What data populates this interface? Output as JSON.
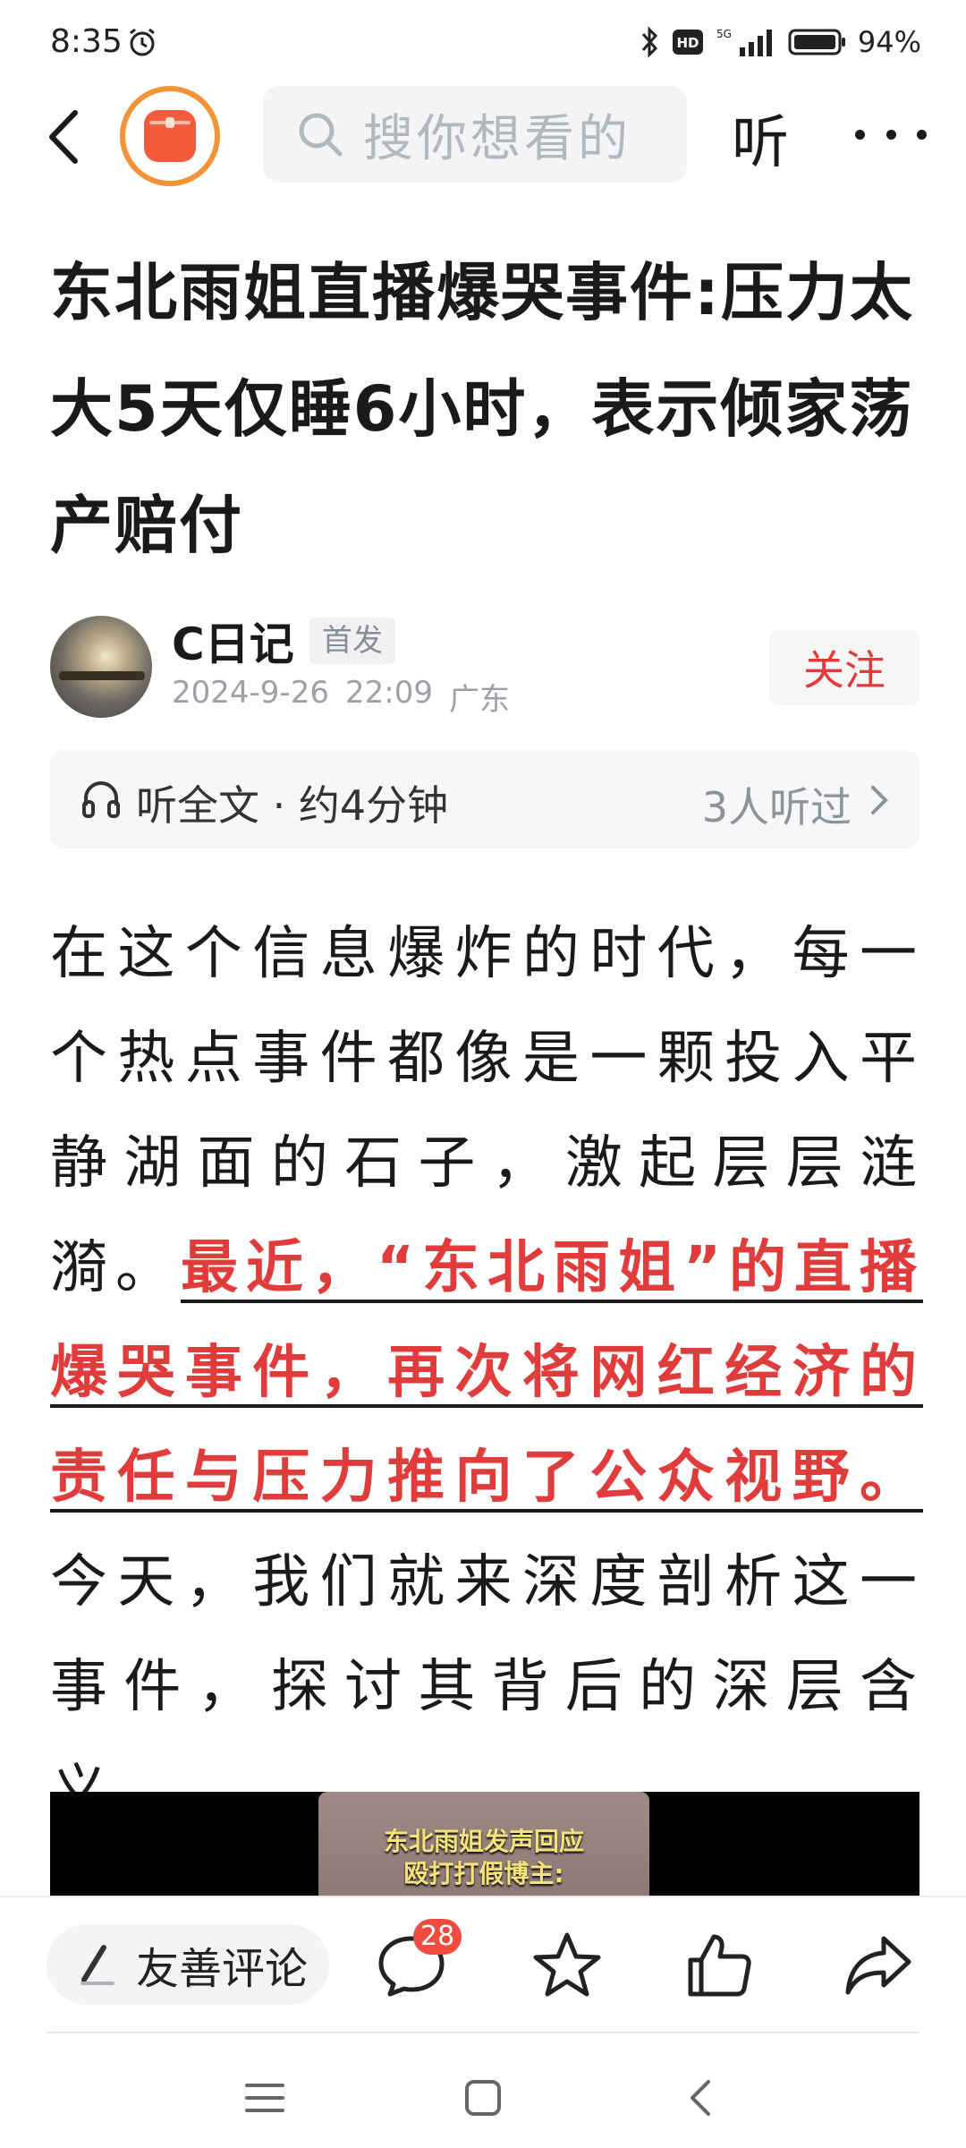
{
  "status_bar": {
    "time": "8:35",
    "network": "5G",
    "battery": "94%",
    "hd_badge": "HD"
  },
  "nav": {
    "search_placeholder": "搜你想看的",
    "listen_label": "听"
  },
  "article": {
    "title": "东北雨姐直播爆哭事件:压力太大5天仅睡6小时，表示倾家荡产赔付",
    "author": "C日记",
    "first_badge": "首发",
    "date": "2024-9-26",
    "time": "22:09",
    "location": "广东",
    "follow_label": "关注",
    "listen_full": "听全文 · 约4分钟",
    "listen_count": "3人听过",
    "body_part1": "在这个信息爆炸的时代，每一个热点事件都像是一颗投入平静湖面的石子，激起层层涟漪。",
    "body_highlight": "最近，“东北雨姐”的直播爆哭事件，再次将网红经济的责任与压力推向了公众视野。",
    "body_part2": "今天，我们就来深度剖析这一事件，探讨其背后的深层含义。",
    "video_caption_line1": "东北雨姐发声回应",
    "video_caption_line2": "殴打打假博主:"
  },
  "toolbar": {
    "comment_placeholder": "友善评论",
    "comment_count": "28"
  },
  "colors": {
    "accent_red": "#e03c3c",
    "logo_orange": "#f39236"
  }
}
